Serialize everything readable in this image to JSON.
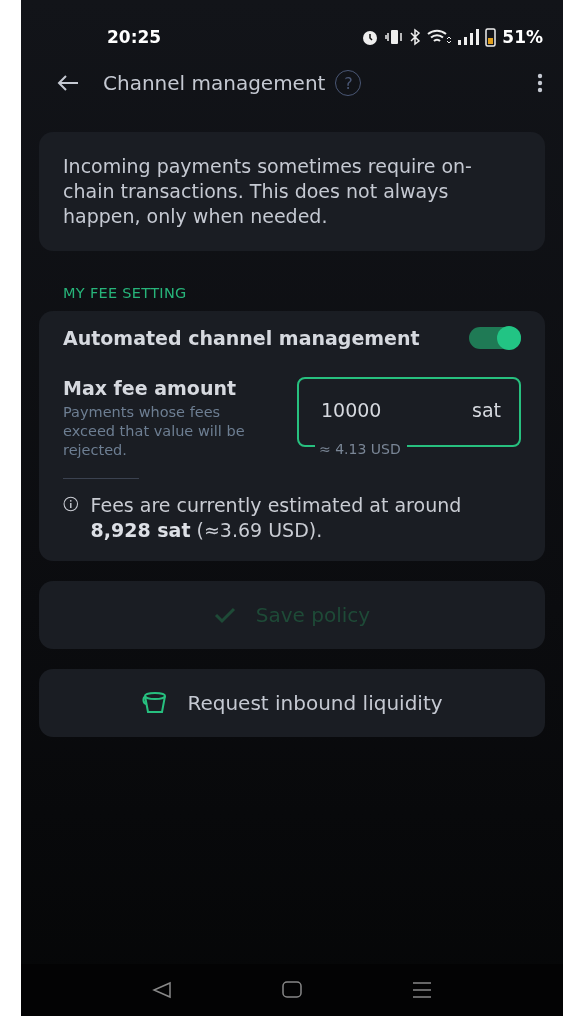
{
  "status_bar": {
    "time": "20:25",
    "battery": "51%"
  },
  "header": {
    "title": "Channel management",
    "help": "?"
  },
  "info_card": {
    "text": "Incoming payments sometimes require on-chain transactions. This does not always happen, only when needed."
  },
  "section": {
    "label": "MY FEE SETTING"
  },
  "fee_card": {
    "toggle": {
      "label": "Automated channel management",
      "on": true
    },
    "max_fee": {
      "label": "Max fee amount",
      "description": "Payments whose fees exceed that value will be rejected.",
      "value": "10000",
      "unit": "sat",
      "converted": "≈ 4.13 USD"
    },
    "estimate": "Fees are currently estimated at around **8,928 sat** (≈3.69 USD)."
  },
  "buttons": [
    {
      "label": "Save policy",
      "kind": "check",
      "disabled": true
    },
    {
      "label": "Request inbound liquidity",
      "kind": "bucket",
      "disabled": false
    }
  ]
}
